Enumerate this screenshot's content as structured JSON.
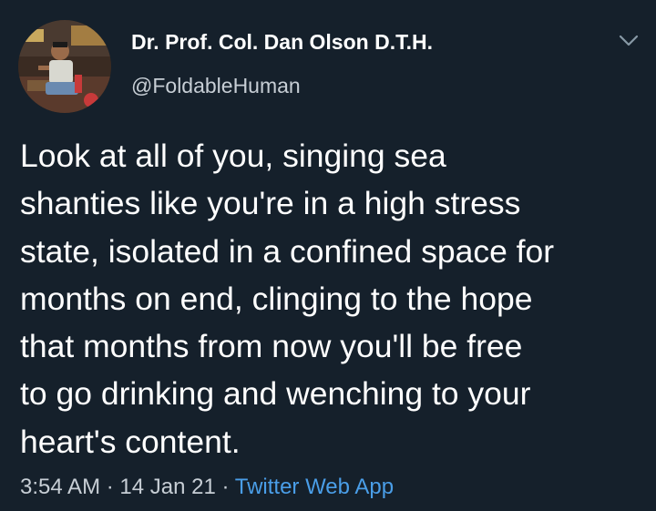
{
  "tweet": {
    "author": {
      "display_name": "Dr. Prof. Col. Dan Olson D.T.H.",
      "handle": "@FoldableHuman"
    },
    "text_lines": [
      "Look at all of you, singing sea",
      "shanties like you're in a high stress",
      "state, isolated in a confined space for",
      "months on end, clinging to the hope",
      "that months from now you'll be free",
      "to go drinking and wenching to your",
      "heart's content."
    ],
    "time": "3:54 AM",
    "separator": "·",
    "date": "14 Jan 21",
    "source": "Twitter Web App"
  },
  "icons": {
    "caret": "chevron-down-icon",
    "avatar": "avatar"
  },
  "colors": {
    "background": "#15202b",
    "primary_text": "#ffffff",
    "secondary_text": "#c7ced5",
    "link": "#4a9ee8"
  }
}
